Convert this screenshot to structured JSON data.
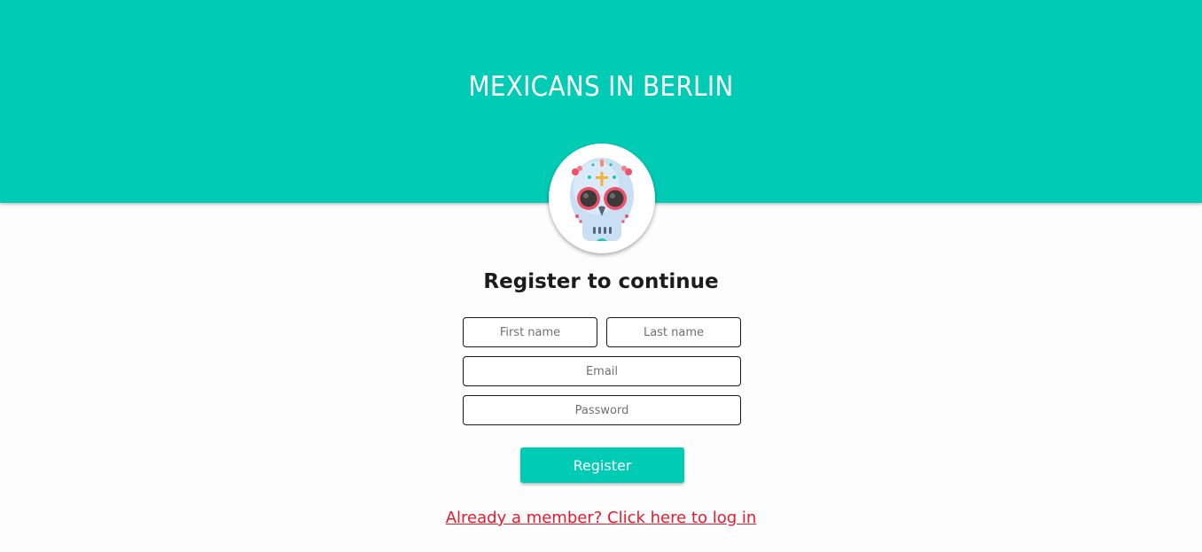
{
  "header": {
    "title": "MEXICANS IN BERLIN",
    "background_color": "#00ccb6"
  },
  "avatar": {
    "icon": "sugar-skull-icon"
  },
  "form": {
    "title": "Register to continue",
    "first_name_placeholder": "First name",
    "last_name_placeholder": "Last name",
    "email_placeholder": "Email",
    "password_placeholder": "Password",
    "submit_label": "Register",
    "login_link": "Already a member? Click here to log in",
    "accent_color": "#00ccb6",
    "link_color": "#e8192c"
  }
}
